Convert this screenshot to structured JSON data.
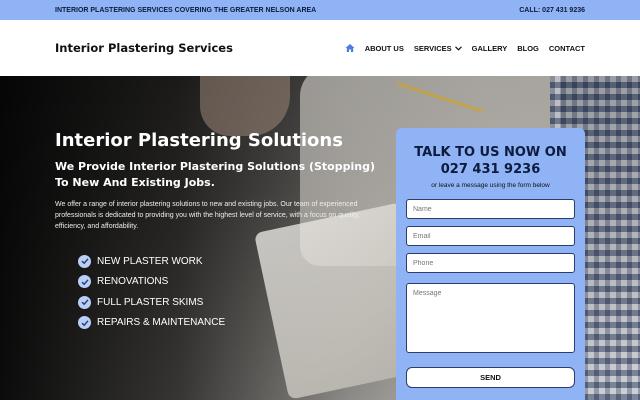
{
  "topbar": {
    "service_area": "INTERIOR PLASTERING SERVICES COVERING THE GREATER NELSON AREA",
    "phone": "CALL: 027 431 9236"
  },
  "header": {
    "brand": "Interior Plastering Services",
    "nav": {
      "home_icon": "home-icon",
      "about": "ABOUT US",
      "services": "SERVICES",
      "gallery": "GALLERY",
      "blog": "BLOG",
      "contact": "CONTACT"
    }
  },
  "hero": {
    "title": "Interior Plastering Solutions",
    "subtitle": "We Provide Interior Plastering Solutions (Stopping) To New And Existing Jobs.",
    "description": "We offer a range of interior plastering solutions to new and existing jobs. Our team of experienced professionals is dedicated to providing you with the highest level of service, with a focus on quality, efficiency, and affordability.",
    "features": [
      "NEW PLASTER WORK",
      "RENOVATIONS",
      "FULL PLASTER SKIMS",
      "REPAIRS & MAINTENANCE"
    ]
  },
  "form": {
    "heading_line1": "TALK TO US NOW ON",
    "heading_line2": "027 431 9236",
    "note": "or leave a message using the form below",
    "name_placeholder": "Name",
    "email_placeholder": "Email",
    "phone_placeholder": "Phone",
    "message_placeholder": "Message",
    "send_label": "SEND"
  },
  "colors": {
    "accent": "#8fb3f5",
    "nav_home_icon": "#4a7fe0"
  }
}
